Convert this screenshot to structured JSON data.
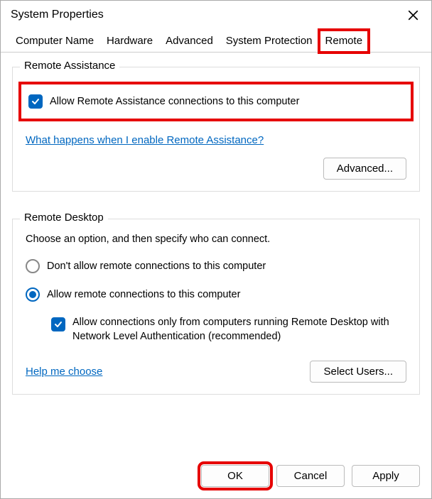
{
  "title": "System Properties",
  "tabs": {
    "computer_name": "Computer Name",
    "hardware": "Hardware",
    "advanced": "Advanced",
    "system_protection": "System Protection",
    "remote": "Remote"
  },
  "remote_assistance": {
    "legend": "Remote Assistance",
    "allow_label": "Allow Remote Assistance connections to this computer",
    "allow_checked": true,
    "help_link": "What happens when I enable Remote Assistance?",
    "advanced_button": "Advanced..."
  },
  "remote_desktop": {
    "legend": "Remote Desktop",
    "intro": "Choose an option, and then specify who can connect.",
    "opt_deny": "Don't allow remote connections to this computer",
    "opt_allow": "Allow remote connections to this computer",
    "nla_label": "Allow connections only from computers running Remote Desktop with Network Level Authentication (recommended)",
    "nla_checked": true,
    "selected": "allow",
    "help_link": "Help me choose",
    "select_users_button": "Select Users..."
  },
  "buttons": {
    "ok": "OK",
    "cancel": "Cancel",
    "apply": "Apply"
  }
}
